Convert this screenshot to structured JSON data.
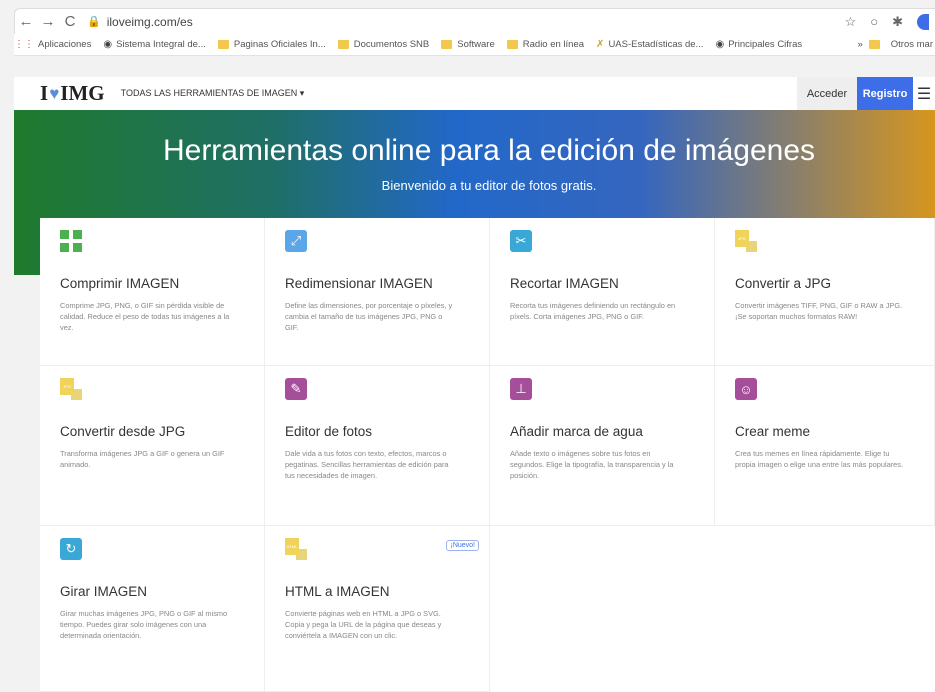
{
  "browser": {
    "url": "iloveimg.com/es",
    "nav_back": "←",
    "nav_forward": "→",
    "nav_reload": "C"
  },
  "bookmarks": {
    "items": [
      "Aplicaciones",
      "Sistema Integral de...",
      "Paginas Oficiales In...",
      "Documentos SNB",
      "Software",
      "Radio en línea",
      "UAS-Estadísticas de...",
      "Principales Cifras"
    ],
    "more": "»",
    "other": "Otros mar"
  },
  "nav": {
    "logo_left": "I",
    "logo_right": "IMG",
    "tools": "TODAS LAS HERRAMIENTAS DE IMAGEN ▾",
    "login": "Acceder",
    "signup": "Registro",
    "menu": "☰"
  },
  "hero": {
    "title": "Herramientas online para la edición de imágenes",
    "subtitle": "Bienvenido a tu editor de fotos gratis."
  },
  "colors": {
    "brand": "#3d6ee8",
    "compress": "#4caf50",
    "resize": "#5ba6e8",
    "crop": "#3aa8d6",
    "jpg": "#f0d35a",
    "editor": "#a54f9a",
    "watermark": "#a54f9a",
    "meme": "#a54f9a",
    "rotate": "#3aa8d6"
  },
  "tools": [
    {
      "title": "Comprimir IMAGEN",
      "desc": "Comprime JPG, PNG, o GIF sin pérdida visible de calidad. Reduce el peso de todas tus imágenes a la vez.",
      "icon": "compress-icon"
    },
    {
      "title": "Redimensionar IMAGEN",
      "desc": "Define las dimensiones, por porcentaje o píxeles, y cambia el tamaño de tus imágenes JPG, PNG o GIF.",
      "icon": "resize-icon"
    },
    {
      "title": "Recortar IMAGEN",
      "desc": "Recorta tus imágenes definiendo un rectángulo en píxels. Corta imágenes JPG, PNG o GIF.",
      "icon": "crop-icon"
    },
    {
      "title": "Convertir a JPG",
      "desc": "Convertir imágenes TIFF, PNG, GIF o RAW a JPG. ¡Se soportan muchos formatos RAW!",
      "icon": "convert-to-jpg-icon",
      "badge": "JPG"
    },
    {
      "title": "Convertir desde JPG",
      "desc": "Transforma imágenes JPG a GIF o genera un GIF animado.",
      "icon": "convert-from-jpg-icon",
      "badge": "JPG"
    },
    {
      "title": "Editor de fotos",
      "desc": "Dale vida a tus fotos con texto, efectos, marcos o pegatinas. Sencillas herramientas de edición para tus necesidades de imagen.",
      "icon": "photo-editor-icon"
    },
    {
      "title": "Añadir marca de agua",
      "desc": "Añade texto o imágenes sobre tus fotos en segundos. Elige la tipografía, la transparencia y la posición.",
      "icon": "watermark-icon"
    },
    {
      "title": "Crear meme",
      "desc": "Crea tus memes en línea rápidamente. Elige tu propia imagen o elige una entre las más populares.",
      "icon": "meme-icon"
    },
    {
      "title": "Girar IMAGEN",
      "desc": "Girar muchas imágenes JPG, PNG o GIF al mismo tiempo. Puedes girar solo imágenes con una determinada orientación.",
      "icon": "rotate-icon"
    },
    {
      "title": "HTML a IMAGEN",
      "desc": "Convierte páginas web en HTML a JPG o SVG. Copia y pega la URL de la página que deseas y conviértela a IMAGEN con un clic.",
      "icon": "html-to-image-icon",
      "badge": "HTML",
      "new": "¡Nuevo!"
    }
  ]
}
